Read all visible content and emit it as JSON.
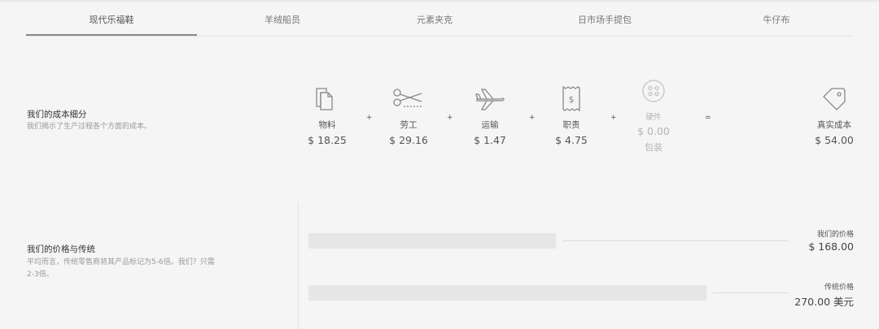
{
  "tabs": [
    "现代乐福鞋",
    "羊绒船员",
    "元素夹克",
    "日市场手提包",
    "牛仔布"
  ],
  "breakdown": {
    "title": "我们的成本细分",
    "subtitle": "我们揭示了生产过程各个方面的成本。",
    "items": [
      {
        "icon": "fabric-icon",
        "label": "物料",
        "value": "$ 18.25"
      },
      {
        "icon": "scissors-icon",
        "label": "劳工",
        "value": "$ 29.16"
      },
      {
        "icon": "airplane-icon",
        "label": "运输",
        "value": "$ 1.47"
      },
      {
        "icon": "receipt-icon",
        "label": "职责",
        "value": "$ 4.75"
      },
      {
        "icon": "button-icon",
        "label": "硬件",
        "value": "$ 0.00",
        "extra": "包装"
      },
      {
        "icon": "tag-icon",
        "label": "真实成本",
        "value": "$ 54.00"
      }
    ],
    "operators": [
      "+",
      "+",
      "+",
      "+",
      "+",
      "="
    ]
  },
  "pricing": {
    "title": "我们的价格与传统",
    "subtitle_line1": "平均而言，传统零售商将其产品标记为5-6倍。我们？只需",
    "subtitle_line2": "2-3倍。",
    "ours": {
      "label": "我们的价格",
      "value": "$ 168.00",
      "amount": 168
    },
    "traditional": {
      "label": "传统价格",
      "value": "270.00 美元",
      "amount": 270
    }
  }
}
